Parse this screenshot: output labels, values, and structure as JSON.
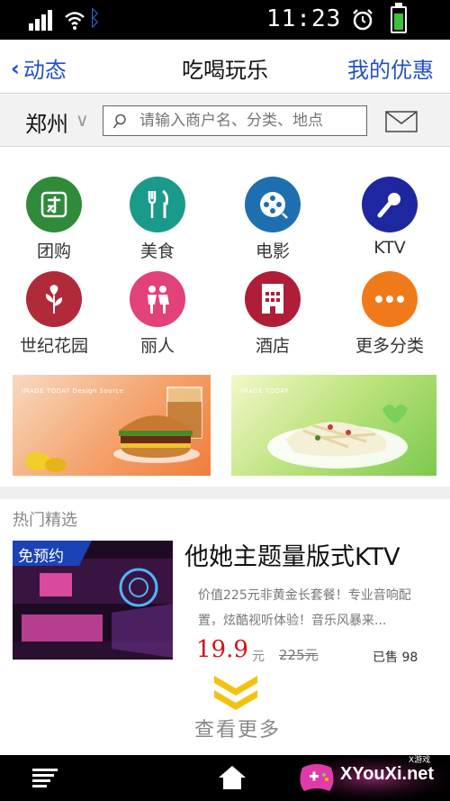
{
  "status_bar": {
    "time": "11:23"
  },
  "nav": {
    "back_label": "动态",
    "title": "吃喝玩乐",
    "right_label": "我的优惠"
  },
  "search": {
    "city": "郑州",
    "placeholder": "请输入商户名、分类、地点"
  },
  "categories": [
    {
      "label": "团购",
      "icon": "group-buy-icon",
      "color": "#2f8a3a"
    },
    {
      "label": "美食",
      "icon": "fork-knife-icon",
      "color": "#1a9a8a"
    },
    {
      "label": "电影",
      "icon": "film-reel-icon",
      "color": "#1e6fb0"
    },
    {
      "label": "KTV",
      "icon": "microphone-icon",
      "color": "#1f27a0"
    },
    {
      "label": "世纪花园",
      "icon": "flower-icon",
      "color": "#b02a3a"
    },
    {
      "label": "丽人",
      "icon": "couple-icon",
      "color": "#e2417a"
    },
    {
      "label": "酒店",
      "icon": "hotel-icon",
      "color": "#b01d38"
    },
    {
      "label": "更多分类",
      "icon": "more-icon",
      "color": "#f07a1a"
    }
  ],
  "banners": [
    {
      "tag": "IMAGE TODAY Design Source"
    },
    {
      "tag": "IMAGE TODAY"
    }
  ],
  "hot": {
    "section_title": "热门精选",
    "item": {
      "tag": "免预约",
      "name": "他她主题量版式KTV",
      "description": "价值225元非黄金长套餐！专业音响配置，炫酷视听体验！音乐风暴来...",
      "price": "19.9",
      "price_unit": "元",
      "original_price": "225元",
      "sold": "已售 98"
    },
    "more_label": "查看更多"
  },
  "watermark": {
    "text": "XYouXi.net",
    "small": "X游戏"
  }
}
